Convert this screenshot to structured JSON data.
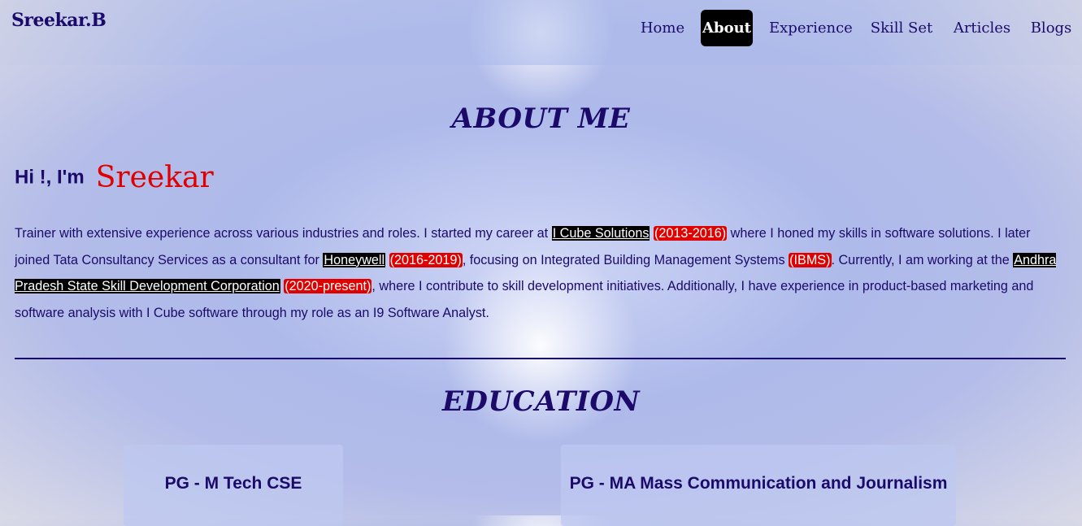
{
  "header": {
    "logo": "Sreekar.B",
    "theme_toggle_icon": "moon-icon",
    "nav": [
      {
        "label": "Home",
        "active": false
      },
      {
        "label": "About",
        "active": true
      },
      {
        "label": "Experience",
        "active": false
      },
      {
        "label": "Skill Set",
        "active": false
      },
      {
        "label": "Articles",
        "active": false
      },
      {
        "label": "Blogs",
        "active": false
      }
    ]
  },
  "about": {
    "title": "ABOUT ME",
    "greeting_prefix": "Hi !, I'm",
    "name": "Sreekar",
    "p1": "Trainer with extensive experience across various industries and roles. I started my career at ",
    "company1": "I Cube Solutions",
    "company1_years": "(2013-2016)",
    "p2": " where I honed my skills in software solutions. I later joined Tata Consultancy Services as a consultant for ",
    "company2": "Honeywell",
    "company2_years": "(2016-2019)",
    "p3": ", focusing on Integrated Building Management Systems ",
    "ibms": "(IBMS)",
    "p4": ". Currently, I am working at the ",
    "company3": "Andhra Pradesh State Skill Development Corporation",
    "company3_years": "(2020-present)",
    "p5": ", where I contribute to skill development initiatives. Additionally, I have experience in product-based marketing and software analysis with I Cube software through my role as an I9 Software Analyst."
  },
  "education": {
    "title": "EDUCATION",
    "cards": [
      {
        "degree": "PG - M Tech CSE"
      },
      {
        "degree": "PG - MA Mass Communication and Journalism"
      }
    ]
  },
  "colors": {
    "primary_text": "#1c0a6b",
    "accent_red": "#e00000",
    "active_nav_bg": "#000000"
  }
}
